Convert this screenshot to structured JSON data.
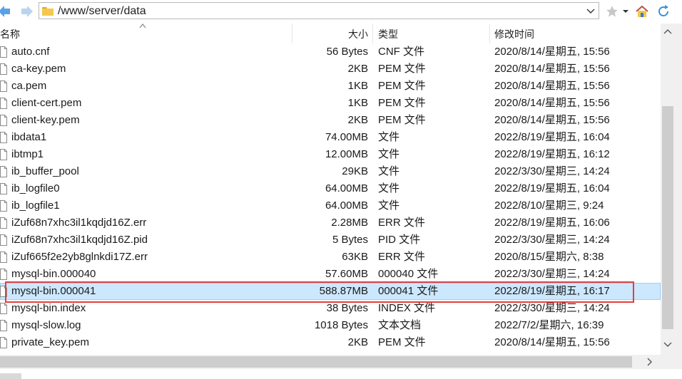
{
  "toolbar": {
    "back_icon": "back-arrow-icon",
    "forward_icon": "forward-arrow-icon",
    "address": "/www/server/data",
    "favorite_icon": "star-icon",
    "home_icon": "home-icon",
    "refresh_icon": "refresh-icon"
  },
  "columns": {
    "name": "名称",
    "size": "大小",
    "type": "类型",
    "modified": "修改时间"
  },
  "files": [
    {
      "name": "auto.cnf",
      "size": "56 Bytes",
      "type": "CNF 文件",
      "modified": "2020/8/14/星期五, 15:56"
    },
    {
      "name": "ca-key.pem",
      "size": "2KB",
      "type": "PEM 文件",
      "modified": "2020/8/14/星期五, 15:56"
    },
    {
      "name": "ca.pem",
      "size": "1KB",
      "type": "PEM 文件",
      "modified": "2020/8/14/星期五, 15:56"
    },
    {
      "name": "client-cert.pem",
      "size": "1KB",
      "type": "PEM 文件",
      "modified": "2020/8/14/星期五, 15:56"
    },
    {
      "name": "client-key.pem",
      "size": "2KB",
      "type": "PEM 文件",
      "modified": "2020/8/14/星期五, 15:56"
    },
    {
      "name": "ibdata1",
      "size": "74.00MB",
      "type": "文件",
      "modified": "2022/8/19/星期五, 16:04"
    },
    {
      "name": "ibtmp1",
      "size": "12.00MB",
      "type": "文件",
      "modified": "2022/8/19/星期五, 16:12"
    },
    {
      "name": "ib_buffer_pool",
      "size": "29KB",
      "type": "文件",
      "modified": "2022/3/30/星期三, 14:24"
    },
    {
      "name": "ib_logfile0",
      "size": "64.00MB",
      "type": "文件",
      "modified": "2022/8/19/星期五, 16:04"
    },
    {
      "name": "ib_logfile1",
      "size": "64.00MB",
      "type": "文件",
      "modified": "2022/8/10/星期三, 9:24"
    },
    {
      "name": "iZuf68n7xhc3il1kqdjd16Z.err",
      "size": "2.28MB",
      "type": "ERR 文件",
      "modified": "2022/8/19/星期五, 16:06"
    },
    {
      "name": "iZuf68n7xhc3il1kqdjd16Z.pid",
      "size": "5 Bytes",
      "type": "PID 文件",
      "modified": "2022/3/30/星期三, 14:24"
    },
    {
      "name": "iZuf665f2e2yb8glnkdi17Z.err",
      "size": "63KB",
      "type": "ERR 文件",
      "modified": "2020/8/15/星期六, 8:38"
    },
    {
      "name": "mysql-bin.000040",
      "size": "57.60MB",
      "type": "000040 文件",
      "modified": "2022/3/30/星期三, 14:24"
    },
    {
      "name": "mysql-bin.000041",
      "size": "588.87MB",
      "type": "000041 文件",
      "modified": "2022/8/19/星期五, 16:17",
      "selected": true
    },
    {
      "name": "mysql-bin.index",
      "size": "38 Bytes",
      "type": "INDEX 文件",
      "modified": "2022/3/30/星期三, 14:24"
    },
    {
      "name": "mysql-slow.log",
      "size": "1018 Bytes",
      "type": "文本文档",
      "modified": "2022/7/2/星期六, 16:39"
    },
    {
      "name": "private_key.pem",
      "size": "2KB",
      "type": "PEM 文件",
      "modified": "2020/8/14/星期五, 15:56"
    }
  ],
  "colors": {
    "selection_bg": "#cce8ff",
    "highlight_border": "#e04040"
  }
}
